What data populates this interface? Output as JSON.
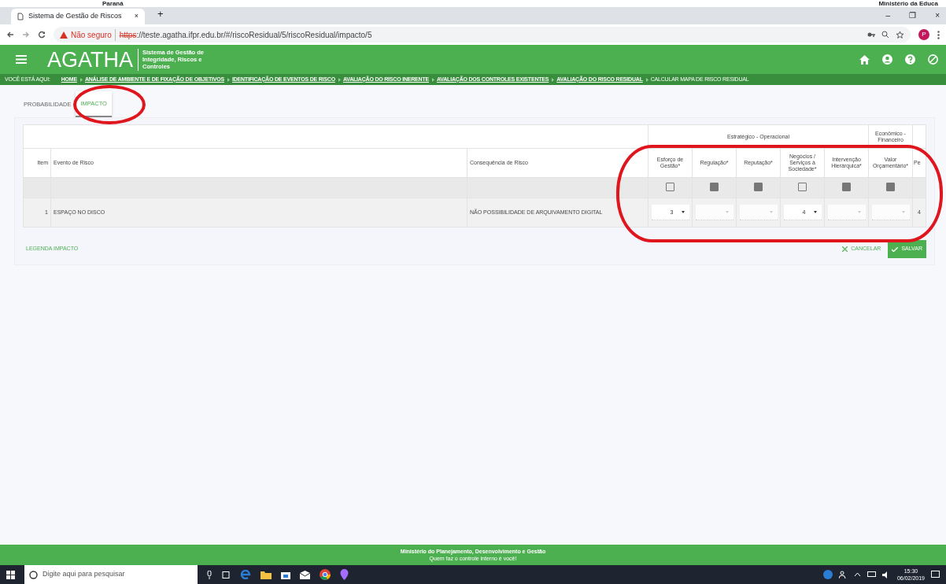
{
  "top_strip": {
    "left_text": "Paraná",
    "right_text": "Ministério da Educa"
  },
  "browser": {
    "tab_title": "Sistema de Gestão de Riscos",
    "tab_close": "×",
    "new_tab": "+",
    "security": "Não seguro",
    "url_protocol": "https",
    "url_rest": "://teste.agatha.ifpr.edu.br/#/riscoResidual/5/riscoResidual/impacto/5",
    "profile_initial": "P",
    "window_controls": [
      "–",
      "❐",
      "×"
    ]
  },
  "app_header": {
    "logo": "AGATHA",
    "subtitle": "Sistema de Gestão de Integridade, Riscos e Controles"
  },
  "breadcrumb": {
    "label": "VOCÊ ESTÁ AQUI:",
    "items": [
      {
        "text": "HOME",
        "link": true
      },
      {
        "text": "ANÁLISE DE AMBIENTE E DE FIXAÇÃO DE OBJETIVOS",
        "link": true
      },
      {
        "text": "IDENTIFICAÇÃO DE EVENTOS DE RISCO",
        "link": true
      },
      {
        "text": "AVALIAÇÃO DO RISCO INERENTE",
        "link": true
      },
      {
        "text": "AVALIAÇÃO DOS CONTROLES EXISTENTES",
        "link": true
      },
      {
        "text": "AVALIAÇÃO DO RISCO RESIDUAL",
        "link": true
      },
      {
        "text": "CALCULAR MAPA DE RISCO RESIDUAL",
        "link": false
      }
    ]
  },
  "tabs": [
    {
      "label": "PROBABILIDADE",
      "selected": false
    },
    {
      "label": "IMPACTO",
      "selected": true
    }
  ],
  "tabs_highlighted": true,
  "table": {
    "columns": [
      "Item",
      "Evento de Risco",
      "Consequência de Risco"
    ],
    "groups": [
      {
        "label": "Estratégico - Operacional",
        "impact_columns": [
          {
            "label": "Esforço de Gestão*",
            "checked": false
          },
          {
            "label": "Regulação*",
            "checked": true
          },
          {
            "label": "Reputação*",
            "checked": true
          },
          {
            "label": "Negócios / Serviços à Sociedade*",
            "checked": false
          },
          {
            "label": "Intervenção Hierárquica*",
            "checked": true
          }
        ]
      },
      {
        "label": "Econômico - Financeiro",
        "impact_columns": [
          {
            "label": "Valor Orçamentário*",
            "checked": true
          }
        ]
      }
    ],
    "last_column": "Pe",
    "rows": [
      {
        "item": "1",
        "event": "ESPAÇO NO DISCO",
        "consequence": "NÃO POSSIBILIDADE DE ARQUIVAMENTO DIGITAL",
        "impacts": [
          {
            "filled": true,
            "value": "3"
          },
          {
            "filled": false
          },
          {
            "filled": false
          },
          {
            "filled": true,
            "value": "4"
          },
          {
            "filled": false
          },
          {
            "filled": false
          }
        ],
        "last": "4"
      }
    ]
  },
  "impact_highlighted": true,
  "legend_link": "LEGENDA IMPACTO",
  "buttons": {
    "cancel": "CANCELAR",
    "save": "SALVAR"
  },
  "footer": {
    "line1": "Ministério do Planejamento, Desenvolvimento e Gestão",
    "line2": "Quem faz o controle interno é você!"
  },
  "taskbar": {
    "search_placeholder": "Digite aqui para pesquisar",
    "time": "15:30",
    "date": "06/02/2019"
  }
}
